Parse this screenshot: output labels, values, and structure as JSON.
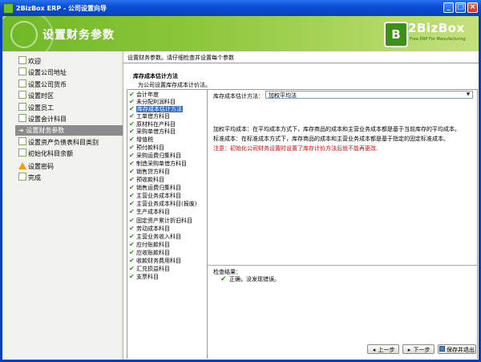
{
  "window": {
    "title": "2BizBox ERP - 公司设置向导",
    "controls": {
      "minimize": "_",
      "maximize": "□",
      "close": "×"
    }
  },
  "header": {
    "title": "设置财务参数",
    "logo_text": "2BizBox",
    "logo_mark": "B",
    "logo_tagline": "Free ERP For Manufacturing"
  },
  "nav": {
    "items": [
      {
        "label": "欢迎",
        "icon": "page-icon"
      },
      {
        "label": "设置公司地址",
        "icon": "page-icon"
      },
      {
        "label": "设置公司货币",
        "icon": "page-icon"
      },
      {
        "label": "设置时区",
        "icon": "page-icon"
      },
      {
        "label": "设置员工",
        "icon": "page-icon"
      },
      {
        "label": "设置会计科目",
        "icon": "page-icon"
      },
      {
        "label": "设置财务参数",
        "icon": "arrow-icon",
        "active": true
      },
      {
        "label": "设置资产负债表科目类别",
        "icon": "page-icon"
      },
      {
        "label": "初始化科目余额",
        "icon": "page-icon"
      },
      {
        "label": "设置密码",
        "icon": "warning-icon"
      },
      {
        "label": "完成",
        "icon": "page-icon"
      }
    ]
  },
  "content": {
    "instruction": "设置财务参数。请仔细检查并设置每个参数",
    "section_title": "库存成本估计方法",
    "section_subtitle": "为公司设置库存成本计价法。"
  },
  "tree": {
    "items": [
      "会计年度",
      "未分配利润科目",
      "库存成本估计方法",
      "工单借方科目",
      "原材料在产科目",
      "采购单借方科目",
      "增值税",
      "预付款科目",
      "采购运费归集科目",
      "制造采购单借方科目",
      "销售贷方科目",
      "预收款科目",
      "销售运费归集科目",
      "主营业务成本科目",
      "主营业务成本科目(报废)",
      "生产成本科目",
      "固定资产累计折旧科目",
      "劳动成本科目",
      "主营业务收入科目",
      "应付账款科目",
      "应收账款科目",
      "收款财务费用科目",
      "汇兑损益科目",
      "支票科目"
    ],
    "selected_index": 2
  },
  "panel": {
    "cost_method_label": "库存成本估计方法：",
    "cost_method_value": "加权平均法",
    "desc_weighted": "加权平均成本：在平均成本方式下，库存商品的成本和主营业务成本都是基于当前库存的平均成本。",
    "desc_standard": "标准成本：在标准成本方式下，库存商品的成本和主营业务成本都是基于指定的固定标准成本。",
    "note": "注意：初始化公司财务设置时设置了库存计价方法后就不能再更改.",
    "result_title": "检查结果：",
    "result_text": "正确，没发现错误。"
  },
  "buttons": {
    "prev": "上一步",
    "next": "下一步",
    "save_exit": "保存并退出"
  },
  "colors": {
    "titlebar": "#0a4ed6",
    "header_green": "#8cc63a",
    "active_nav": "#8b8b8b",
    "note_red": "#e00000",
    "check_green": "#2e8c1a"
  }
}
